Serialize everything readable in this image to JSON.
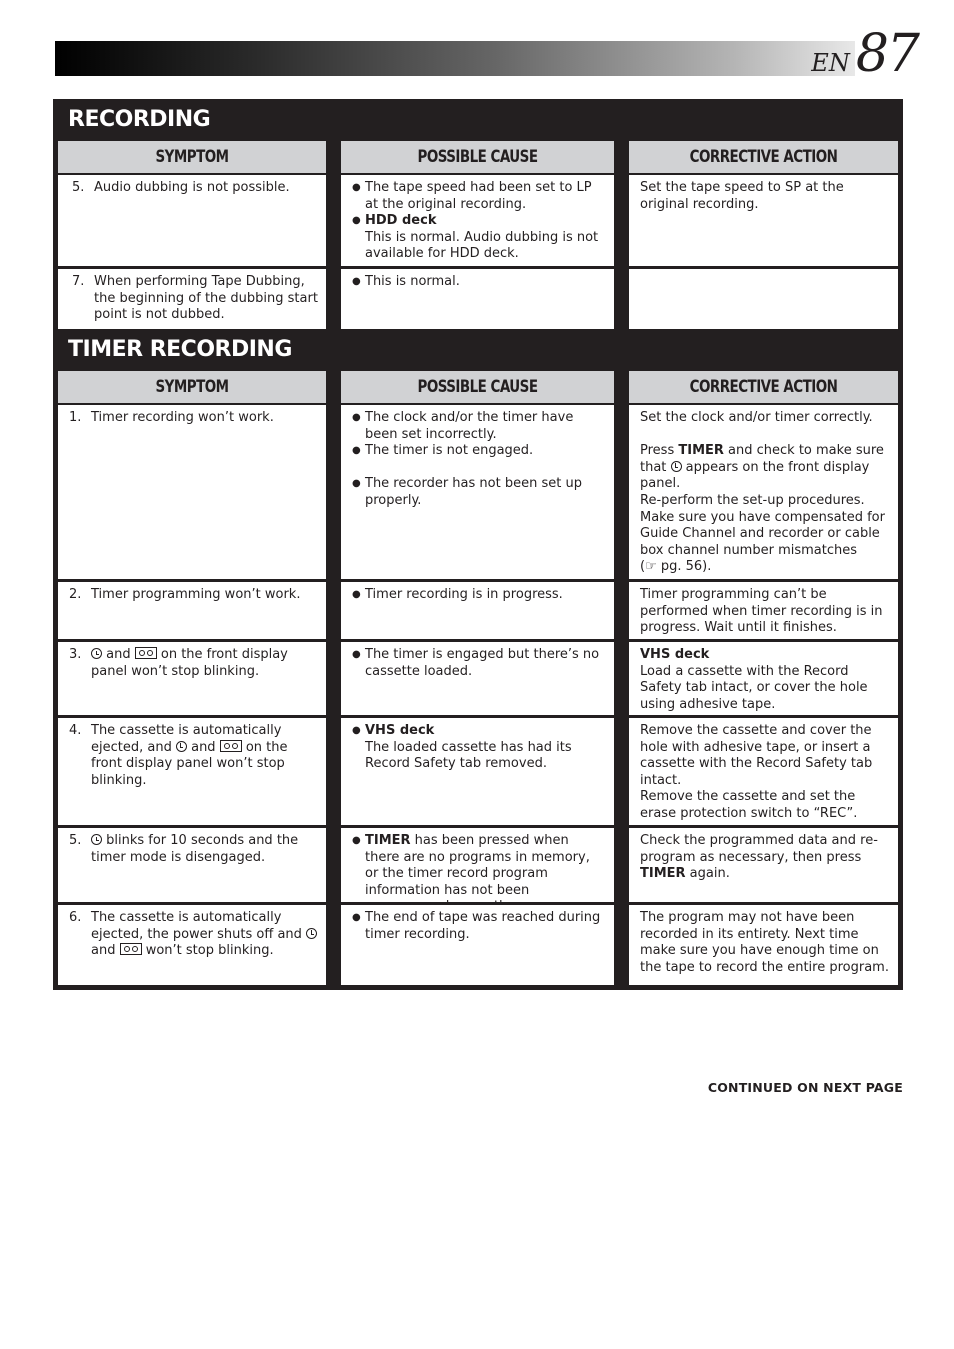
{
  "header": {
    "lang": "EN",
    "page_number": "87"
  },
  "recording": {
    "title": "RECORDING",
    "columns": [
      "SYMPTOM",
      "POSSIBLE CAUSE",
      "CORRECTIVE ACTION"
    ],
    "rows": [
      {
        "num": "5.",
        "symptom": "Audio dubbing is not possible.",
        "cause_1": "The tape speed had been set to LP at the original recording.",
        "cause_2_bold": "HDD deck",
        "cause_2": "This is normal. Audio dubbing is not available for HDD deck.",
        "action": "Set the tape speed to SP at the original recording."
      },
      {
        "num": "7.",
        "symptom": "When performing Tape Dubbing, the beginning of the dubbing start point is not dubbed.",
        "cause_1": "This is normal.",
        "action": ""
      }
    ]
  },
  "timer_recording": {
    "title": "TIMER RECORDING",
    "columns": [
      "SYMPTOM",
      "POSSIBLE CAUSE",
      "CORRECTIVE ACTION"
    ],
    "rows": [
      {
        "num": "1.",
        "symptom": "Timer recording won’t work.",
        "cause_1": "The clock and/or the timer have been set incorrectly.",
        "cause_2": "The timer is not engaged.",
        "cause_3": "The recorder has not been set up properly.",
        "action_1": "Set the clock and/or timer correctly.",
        "action_2a": "Press ",
        "action_2b": "TIMER",
        "action_2c": " and check to make sure that ",
        "action_2d": " appears on the front display panel.",
        "action_3": "Re-perform the set-up procedures. Make sure you have compensated for Guide Channel and recorder or cable box channel number mismatches",
        "action_3_ref": "(☞ pg. 56)."
      },
      {
        "num": "2.",
        "symptom": "Timer programming won’t work.",
        "cause_1": "Timer recording is in progress.",
        "action": "Timer programming can’t be performed when timer recording is in progress. Wait until it finishes."
      },
      {
        "num": "3.",
        "symptom_a": " and ",
        "symptom_b": " on the front display panel won’t stop blinking.",
        "cause_1": "The timer is engaged but there’s no cassette loaded.",
        "action_bold": "VHS deck",
        "action": "Load a cassette with the Record Safety tab intact, or cover the hole using adhesive tape."
      },
      {
        "num": "4.",
        "symptom_a": "The cassette is automatically ejected, and ",
        "symptom_b": " and ",
        "symptom_c": " on the front display panel won’t stop blinking.",
        "cause_bold": "VHS deck",
        "cause_1": "The loaded cassette has had its Record Safety tab removed.",
        "action_1": "Remove the cassette and cover the hole with adhesive tape, or insert a cassette with the Record Safety tab intact.",
        "action_2": "Remove the cassette and set the erase protection switch to “REC”."
      },
      {
        "num": "5.",
        "symptom_a": " blinks for 10 seconds and the timer mode is disengaged.",
        "cause_bold": "TIMER",
        "cause_1": " has been pressed when there are no programs in memory, or the timer record program information has not been programmed correctly.",
        "action_a": "Check the programmed data and re-program as necessary, then press ",
        "action_bold": "TIMER",
        "action_b": " again."
      },
      {
        "num": "6.",
        "symptom_a": "The cassette is automatically ejected, the power shuts off and ",
        "symptom_b": " and ",
        "symptom_c": " won’t stop blinking.",
        "cause_1": "The end of tape was reached during timer recording.",
        "action": "The program may not have been recorded in its entirety. Next time make sure you have enough time on the tape to record the entire program."
      }
    ]
  },
  "footer": {
    "continued": "CONTINUED ON NEXT PAGE"
  },
  "bullet": "●"
}
